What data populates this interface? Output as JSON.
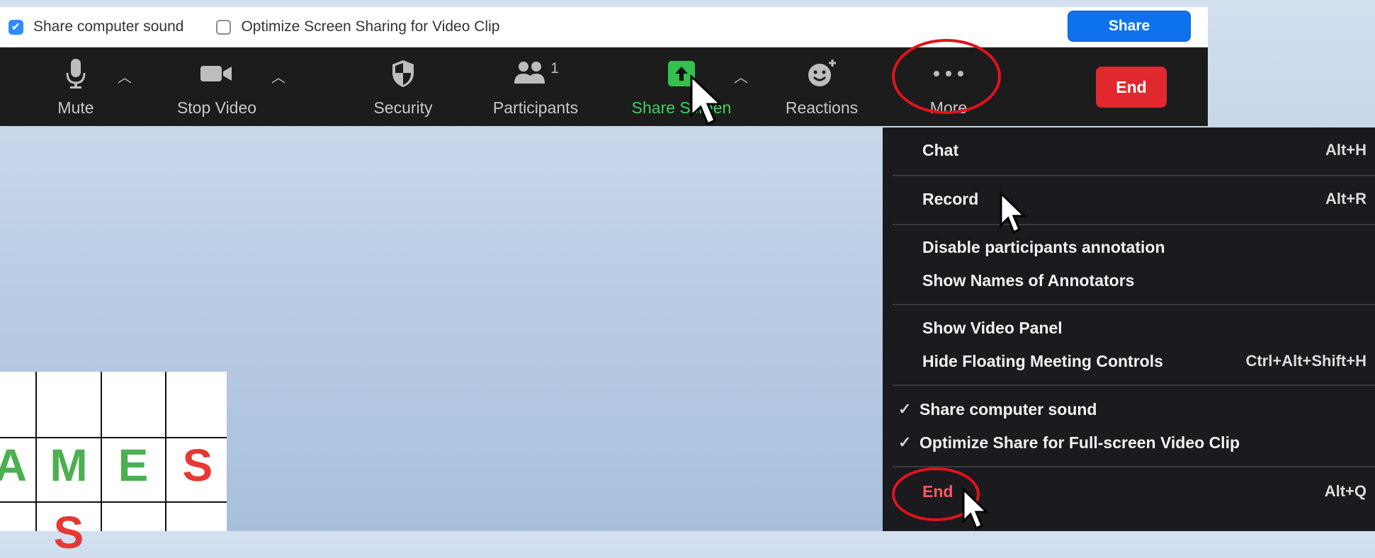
{
  "share_bar": {
    "option1": {
      "label": "Share computer sound",
      "checked": true
    },
    "option2": {
      "label": "Optimize Screen Sharing for Video Clip",
      "checked": false
    },
    "share_button": "Share"
  },
  "toolbar": {
    "mute": "Mute",
    "stop_video": "Stop Video",
    "security": "Security",
    "participants": "Participants",
    "participants_count": "1",
    "share_screen": "Share Screen",
    "reactions": "Reactions",
    "more": "More",
    "end": "End"
  },
  "menu": {
    "items": [
      {
        "label": "Chat",
        "shortcut": "Alt+H"
      },
      {
        "label": "Record",
        "shortcut": "Alt+R"
      },
      {
        "label": "Disable participants annotation",
        "shortcut": ""
      },
      {
        "label": "Show Names of Annotators",
        "shortcut": ""
      },
      {
        "label": "Show Video Panel",
        "shortcut": ""
      },
      {
        "label": "Hide Floating Meeting Controls",
        "shortcut": "Ctrl+Alt+Shift+H"
      },
      {
        "label": "Share computer sound",
        "shortcut": "",
        "checked": true
      },
      {
        "label": "Optimize Share for Full-screen Video Clip",
        "shortcut": "",
        "checked": true
      },
      {
        "label": "End",
        "shortcut": "Alt+Q"
      }
    ]
  },
  "game_grid": {
    "letters": [
      "A",
      "M",
      "E",
      "S"
    ],
    "partial_letter": "S"
  },
  "colors": {
    "accent_blue": "#0e72ed",
    "share_green": "#3ed35c",
    "end_red": "#e0282e",
    "highlight_ring": "#e0131b",
    "letter_green": "#4caf50",
    "letter_red": "#e53935"
  }
}
